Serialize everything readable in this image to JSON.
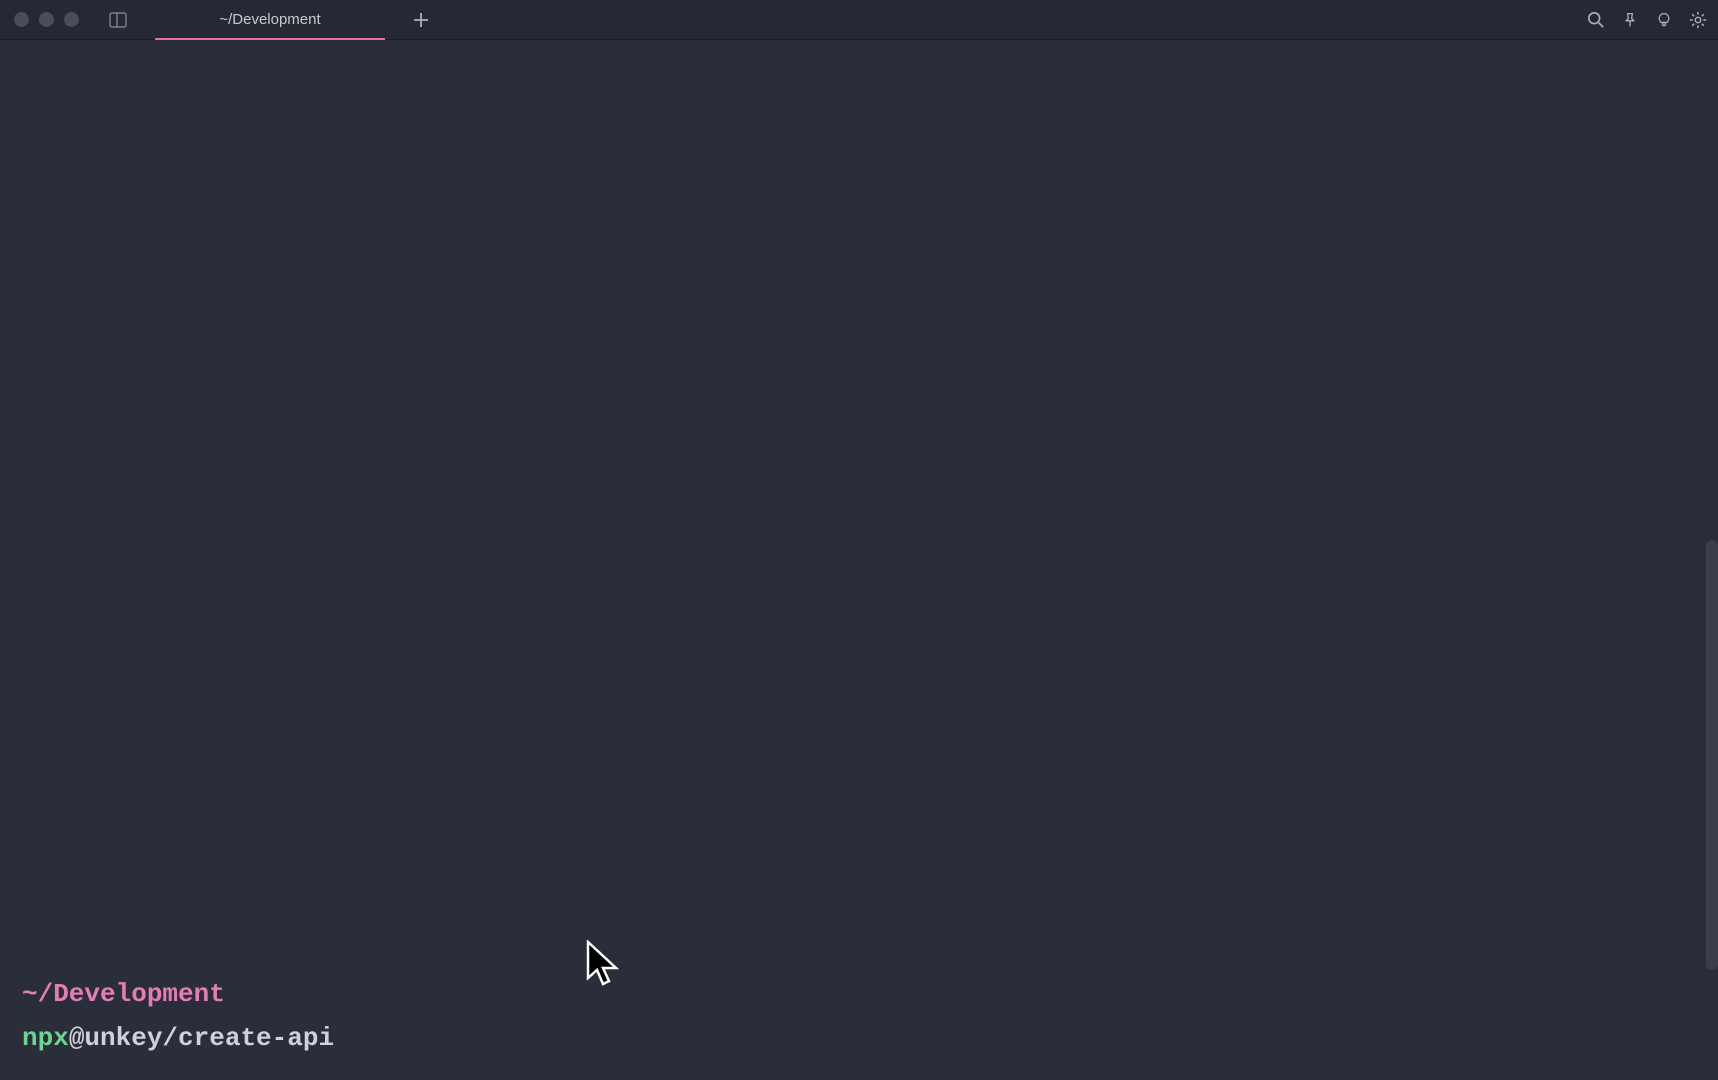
{
  "window": {
    "tab_title": "~/Development"
  },
  "terminal": {
    "prompt_path": "~/Development",
    "command_exec": "npx",
    "command_args": " @unkey/create-api"
  },
  "colors": {
    "bg": "#2a2d3a",
    "tab_underline": "#e86ca5",
    "prompt": "#e47db4",
    "exec": "#6bd48e",
    "text": "#d0d0d8"
  }
}
